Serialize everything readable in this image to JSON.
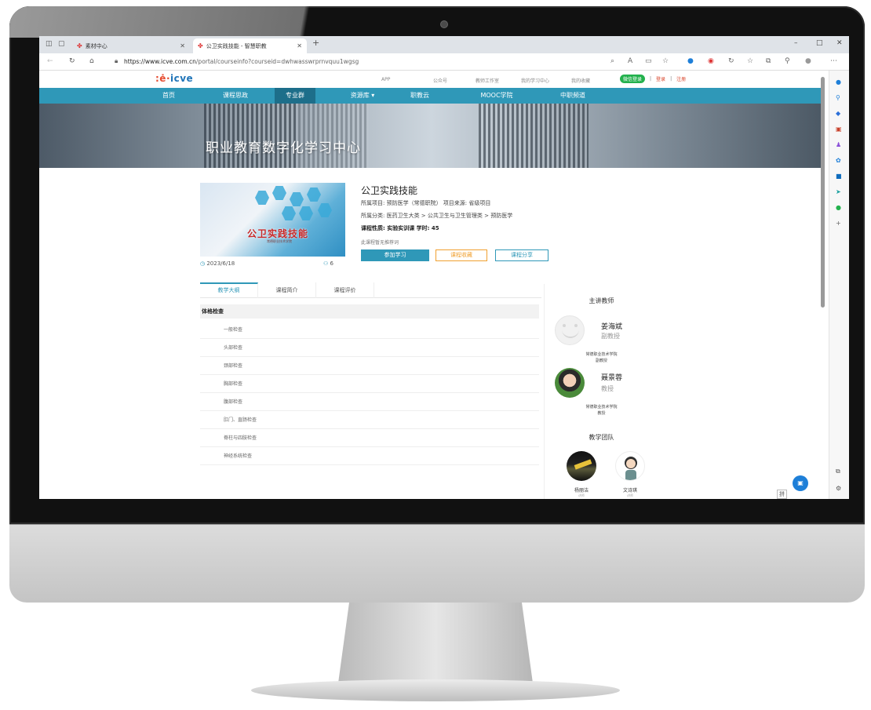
{
  "browser": {
    "tabs": [
      {
        "label": "素材中心"
      },
      {
        "label": "公卫实践技能 - 智慧职教"
      }
    ],
    "new_tab": "+",
    "url_host": "https://www.icve.com.cn",
    "url_path": "/portal/courseinfo?courseid=dwhwasswrprnvquu1wgsg",
    "window_controls": [
      "–",
      "□",
      "✕"
    ]
  },
  "site": {
    "logo": "icve",
    "top_links": [
      "APP",
      "公众号",
      "教师工作室",
      "我的学习中心",
      "我的收藏"
    ],
    "wechat_login": "微信登录",
    "login": "登录",
    "register": "注册",
    "separator": "|",
    "nav": [
      "首页",
      "课程思政",
      "专业群",
      "资源库 ▾",
      "职教云",
      "MOOC学院",
      "中职频道"
    ],
    "nav_active_index": 2,
    "banner_title": "职业教育数字化学习中心"
  },
  "course": {
    "cover_title": "公卫实践技能",
    "cover_sub": "常德职业技术学院",
    "title": "公卫实践技能",
    "project": "所属项目: 预防医学（常德职院）   项目来源: 省级项目",
    "category": "所属分类: 医药卫生大类 > 公共卫生与卫生管理类 > 预防医学",
    "nature": "课程性质: 实验实训课      学时: 45",
    "note": "此课程暂无推荐词",
    "date": "2023/6/18",
    "learners": "6",
    "join_btn": "参加学习",
    "fav_btn": "课程收藏",
    "share_btn": "课程分享"
  },
  "syllabus": {
    "tabs": [
      "教学大纲",
      "课程简介",
      "课程评价"
    ],
    "chapter": "体格检查",
    "lessons": [
      "一般检查",
      "头部检查",
      "颈部检查",
      "胸部检查",
      "腹部检查",
      "肛门、直肠检查",
      "脊柱与四肢检查",
      "神经系统检查"
    ]
  },
  "teachers": {
    "heading": "主讲教师",
    "list": [
      {
        "name": "姜海斌",
        "title": "副教授",
        "school": "常德职业技术学院",
        "role": "副教授"
      },
      {
        "name": "聂景蓉",
        "title": "教授",
        "school": "常德职业技术学院",
        "role": "教授"
      }
    ],
    "team_heading": "教学团队",
    "team": [
      {
        "name": "杨丽洁",
        "role": "讲师"
      },
      {
        "name": "文诗琪",
        "role": "讲师"
      }
    ]
  },
  "misc": {
    "ime": "拼",
    "float_btn": "▣"
  }
}
